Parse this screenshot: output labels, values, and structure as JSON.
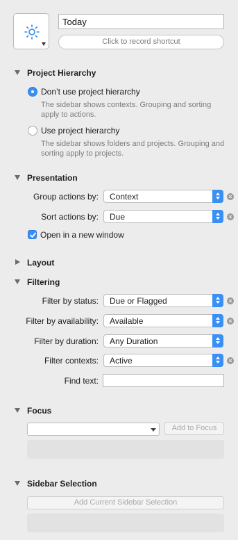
{
  "header": {
    "icon": "sun-icon",
    "name_value": "Today",
    "shortcut_label": "Click to record shortcut"
  },
  "project_hierarchy": {
    "title": "Project Hierarchy",
    "options": [
      {
        "label": "Don’t use project hierarchy",
        "selected": true,
        "description": "The sidebar shows contexts. Grouping and sorting apply to actions."
      },
      {
        "label": "Use project hierarchy",
        "selected": false,
        "description": "The sidebar shows folders and projects. Grouping and sorting apply to projects."
      }
    ]
  },
  "presentation": {
    "title": "Presentation",
    "group_label": "Group actions by:",
    "group_value": "Context",
    "sort_label": "Sort actions by:",
    "sort_value": "Due",
    "new_window_label": "Open in a new window",
    "new_window_checked": true
  },
  "layout": {
    "title": "Layout"
  },
  "filtering": {
    "title": "Filtering",
    "status_label": "Filter by status:",
    "status_value": "Due or Flagged",
    "availability_label": "Filter by availability:",
    "availability_value": "Available",
    "duration_label": "Filter by duration:",
    "duration_value": "Any Duration",
    "contexts_label": "Filter contexts:",
    "contexts_value": "Active",
    "find_label": "Find text:",
    "find_value": ""
  },
  "focus": {
    "title": "Focus",
    "combo_value": "",
    "add_button": "Add to Focus"
  },
  "sidebar_selection": {
    "title": "Sidebar Selection",
    "add_button": "Add Current Sidebar Selection"
  },
  "colors": {
    "accent": "#3a8ff5",
    "background": "#ececec"
  }
}
